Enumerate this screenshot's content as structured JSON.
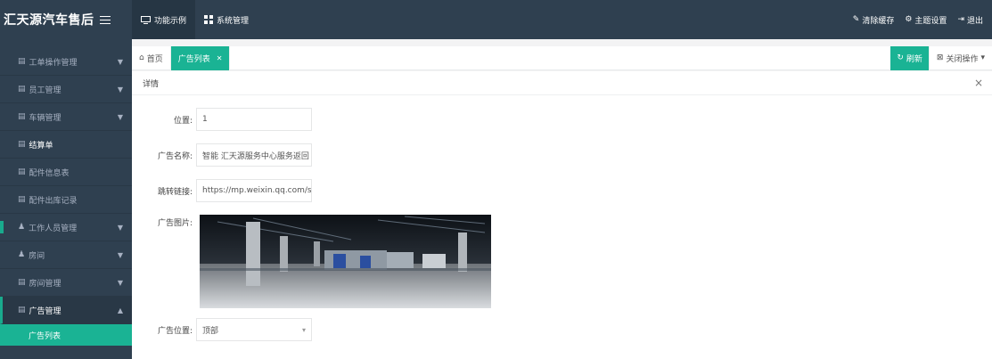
{
  "app": {
    "brand": "汇天源汽车售后"
  },
  "top_nav": [
    {
      "label": "功能示例"
    },
    {
      "label": "系统管理"
    }
  ],
  "top_right": {
    "clear_cache": "清除缓存",
    "theme": "主题设置",
    "logout": "退出"
  },
  "sidebar": {
    "items": [
      {
        "label": "工单操作管理"
      },
      {
        "label": "员工管理"
      },
      {
        "label": "车辆管理"
      },
      {
        "label": "结算单"
      },
      {
        "label": "配件信息表"
      },
      {
        "label": "配件出库记录"
      },
      {
        "label": "工作人员管理"
      },
      {
        "label": "房间"
      },
      {
        "label": "房间管理"
      },
      {
        "label": "广告管理"
      }
    ],
    "active_sub": "广告列表"
  },
  "tabs": [
    {
      "label": "首页"
    },
    {
      "label": "广告列表"
    }
  ],
  "tab_actions": {
    "refresh": "刷新",
    "close_ops": "关闭操作"
  },
  "detail": {
    "title": "详情",
    "fields": {
      "position_label": "位置",
      "position_value": "1",
      "name_label": "广告名称",
      "name_value": "智能 汇天源服务中心服务返回",
      "link_label": "跳转链接",
      "link_value": "https://mp.weixin.qq.com/s/j",
      "image_label": "广告图片",
      "location_label": "广告位置",
      "location_value": "顶部"
    }
  },
  "colors": {
    "nav_dark": "#2f4050",
    "accent_green": "#1ab394"
  }
}
